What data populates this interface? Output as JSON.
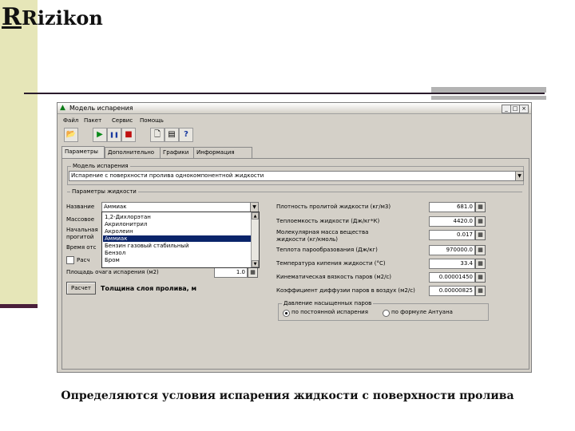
{
  "slide": {
    "logo": "Rizikon",
    "caption": "Определяются условия испарения жидкости с поверхности пролива"
  },
  "window": {
    "title": "Модель испарения",
    "controls": [
      "_",
      "□",
      "×"
    ]
  },
  "menu": [
    "Файл",
    "Пакет",
    "Сервис",
    "Помощь"
  ],
  "toolbar": {
    "buttons": [
      {
        "name": "open",
        "glyph": "📂"
      },
      {
        "name": "run",
        "glyph": "▶"
      },
      {
        "name": "pause",
        "glyph": "❚❚"
      },
      {
        "name": "stop",
        "glyph": "■"
      },
      {
        "name": "new",
        "glyph": "🗋"
      },
      {
        "name": "report",
        "glyph": "▤"
      },
      {
        "name": "help",
        "glyph": "?"
      }
    ]
  },
  "tabs": [
    "Параметры",
    "Дополнительно",
    "Графики",
    "Информация"
  ],
  "model_group": {
    "title": "Модель испарения",
    "selected": "Испарение с поверхности пролива однокомпонентной жидкости"
  },
  "liquid_group": {
    "title": "Параметры жидкости",
    "name_label": "Название",
    "name_value": "Аммиак",
    "row_labels": {
      "mass": "Массовое",
      "initial_1": "Начальная",
      "initial_2": "прогитой",
      "time": "Время отс"
    },
    "checkbox_label": "Расч",
    "area_label": "Площадь очага испарения (м2)",
    "area_value": "1.0",
    "calc_button": "Расчет",
    "thickness_label": "Толщина слоя пролива, м",
    "dropdown_items": [
      "1,2-Дихлорэтан",
      "Акрилонитрил",
      "Акролеин",
      "Аммиак",
      "Бензин газовый стабильный",
      "Бензол",
      "Бром"
    ],
    "dropdown_selected_index": 3
  },
  "properties": [
    {
      "label": "Плотность пролитой жидкости (кг/м3)",
      "value": "681.0"
    },
    {
      "label": "Теплоемкость жидкости (Дж/кг*К)",
      "value": "4420.0"
    },
    {
      "label": "Молекулярная масса вещества",
      "label2": "жидкости (кг/кмоль)",
      "value": "0.017"
    },
    {
      "label": "Теплота парообразования (Дж/кг)",
      "value": "970000.0"
    },
    {
      "label": "Температура кипения жидкости (°С)",
      "value": "33.4"
    },
    {
      "label": "Кинематическая вязкость паров (м2/с)",
      "value": "0.00001450"
    },
    {
      "label": "Коэффициент диффузии паров в воздух (м2/с)",
      "value": "0.00000825"
    }
  ],
  "vapor_pressure": {
    "title": "Давление насыщенных паров",
    "option1": "по постоянной испарения",
    "option2": "по формуле Антуана",
    "selected": 0
  }
}
